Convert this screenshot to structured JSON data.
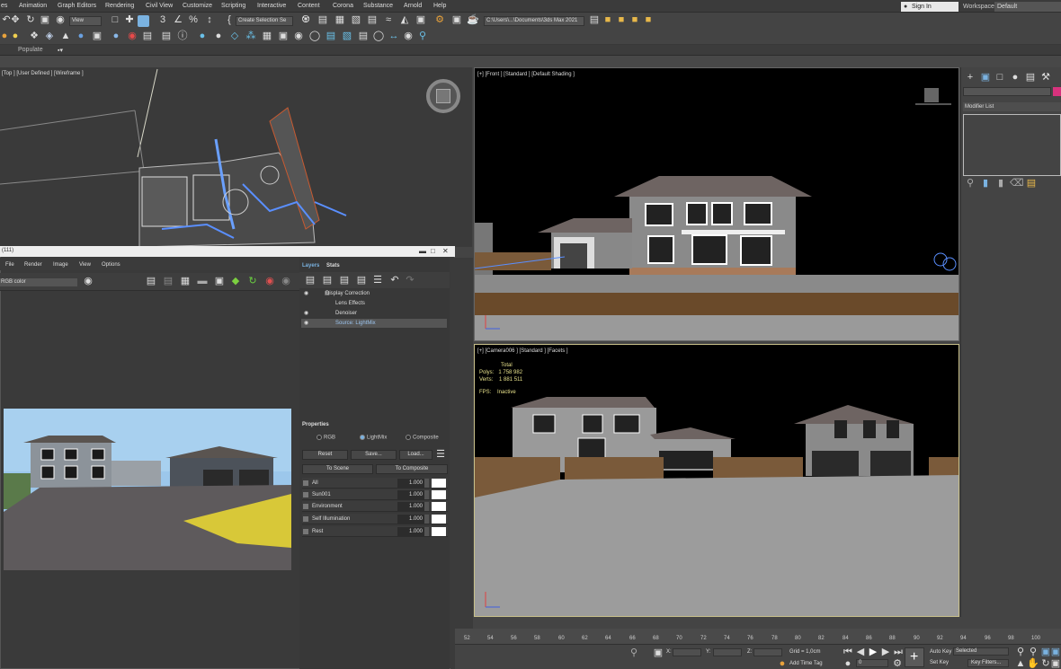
{
  "menubar": {
    "items": [
      "es",
      "Animation",
      "Graph Editors",
      "Rendering",
      "Civil View",
      "Customize",
      "Scripting",
      "Interactive",
      "Content",
      "Corona",
      "Substance",
      "Arnold",
      "Help"
    ],
    "signin": "Sign In",
    "workspaces_label": "Workspaces:",
    "workspace": "Default"
  },
  "toolbar": {
    "view_drop": "View",
    "selection_set": "Create Selection Se",
    "path": "C:\\Users\\...\\Documents\\3ds Max 2021"
  },
  "ribbon": {
    "populate": "Populate",
    "dropdown": "▪▾"
  },
  "viewports": {
    "top_label": "[Top ] [User Defined ] [Wireframe ]",
    "front_label": "[+] [Front ] [Standard ] [Default Shading ]",
    "camera_label": "[+] [Camera006 ] [Standard ] [Facets ]",
    "stats": {
      "total": "Total",
      "polys_label": "Polys:",
      "polys": "1 758 982",
      "verts_label": "Verts:",
      "verts": "1 881 511",
      "fps_label": "FPS:",
      "fps": "Inactive"
    }
  },
  "command_panel": {
    "modifier_list": "Modifier List"
  },
  "frame_buffer": {
    "title": "(111)",
    "menu": [
      "File",
      "Render",
      "Image",
      "View",
      "Options"
    ],
    "channel": "RGB color",
    "tabs": [
      "Layers",
      "Stats"
    ],
    "layers": [
      {
        "name": "Display Correction",
        "eye": "◉"
      },
      {
        "name": "Lens Effects",
        "eye": ""
      },
      {
        "name": "Denoiser",
        "eye": "◉"
      },
      {
        "name": "Source: LightMix",
        "eye": "◉"
      }
    ],
    "properties": "Properties",
    "radios": [
      "RGB",
      "LightMix",
      "Composite"
    ],
    "buttons": {
      "reset": "Reset",
      "save": "Save...",
      "load": "Load...",
      "to_scene": "To Scene",
      "to_composite": "To Composite"
    },
    "mix": [
      {
        "name": "All",
        "value": "1.000"
      },
      {
        "name": "Sun001",
        "value": "1.000"
      },
      {
        "name": "Environment",
        "value": "1.000"
      },
      {
        "name": "Self Illumination",
        "value": "1.000"
      },
      {
        "name": "Rest",
        "value": "1.000"
      }
    ]
  },
  "timeline": {
    "ticks": [
      "52",
      "54",
      "56",
      "58",
      "60",
      "62",
      "64",
      "66",
      "68",
      "70",
      "72",
      "74",
      "76",
      "78",
      "80",
      "82",
      "84",
      "86",
      "88",
      "90",
      "92",
      "94",
      "96",
      "98",
      "100"
    ]
  },
  "statusbar": {
    "x_label": "X:",
    "y_label": "Y:",
    "z_label": "Z:",
    "grid": "Grid = 1,0cm",
    "add_time_tag": "Add Time Tag",
    "auto_key": "Auto Key",
    "set_key": "Set Key",
    "selected": "Selected",
    "key_filters": "Key Filters...",
    "frame": "0"
  }
}
